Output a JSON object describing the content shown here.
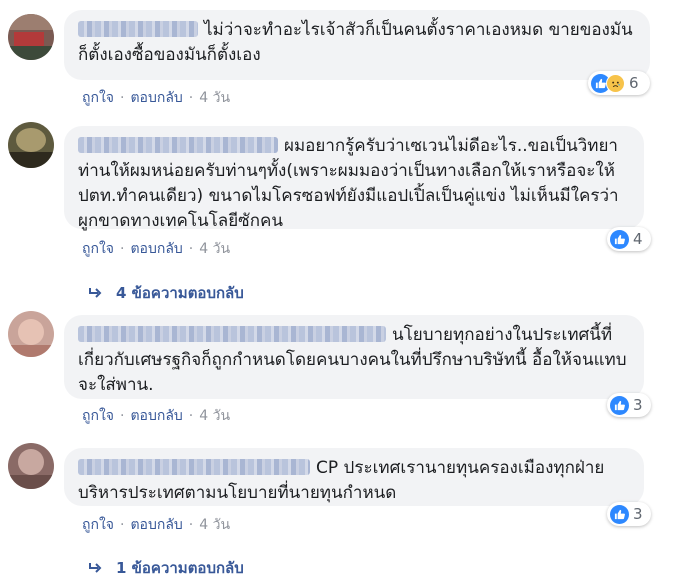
{
  "comments": [
    {
      "author_blurred": true,
      "text": "ไม่ว่าจะทำอะไรเจ้าสัวก็เป็นคนตั้งราคาเองหมด ขายของมันก็ตั้งเองซื้อของมันก็ตั้งเอง",
      "reactions": {
        "icons": [
          "like-icon",
          "sad-icon"
        ],
        "count": "6"
      },
      "like_label": "ถูกใจ",
      "reply_label": "ตอบกลับ",
      "time": "4 วัน"
    },
    {
      "author_blurred": true,
      "text": "ผมอยากรู้ครับว่าเซเวนไม่ดีอะไร..ขอเป็นวิทยาท่านให้ผมหน่อยครับท่านๆทั้ง(เพราะผมมองว่าเป็นทางเลือกให้เราหรือจะให้ปตท.ทำคนเดียว) ขนาดไมโครซอฟท์ยังมีแอปเปิ้ลเป็นคู่แข่ง ไม่เห็นมีใครว่าผูกขาดทางเทคโนโลยีซักคน",
      "reactions": {
        "icons": [
          "like-icon"
        ],
        "count": "4"
      },
      "like_label": "ถูกใจ",
      "reply_label": "ตอบกลับ",
      "time": "4 วัน",
      "replies_label": "4 ข้อความตอบกลับ"
    },
    {
      "author_blurred": true,
      "text": "นโยบายทุกอย่างในประเทศนี้ที่เกี่ยวกับเศษรฐกิจก็ถูกกำหนดโดยคนบางคนในที่ปรึกษาบริษัทนี้ อื้อให้จนแทบจะใส่พาน.",
      "reactions": {
        "icons": [
          "like-icon"
        ],
        "count": "3"
      },
      "like_label": "ถูกใจ",
      "reply_label": "ตอบกลับ",
      "time": "4 วัน"
    },
    {
      "author_blurred": true,
      "text": "CP ประเทศเรานายทุนครองเมืองทุกฝ่ายบริหารประเทศตามนโยบายที่นายทุนกำหนด",
      "reactions": {
        "icons": [
          "like-icon"
        ],
        "count": "3"
      },
      "like_label": "ถูกใจ",
      "reply_label": "ตอบกลับ",
      "time": "4 วัน",
      "replies_label": "1 ข้อความตอบกลับ"
    }
  ],
  "colors": {
    "link": "#385898",
    "bubble": "#f2f3f5",
    "like": "#2d88ff",
    "meta": "#90949c"
  }
}
